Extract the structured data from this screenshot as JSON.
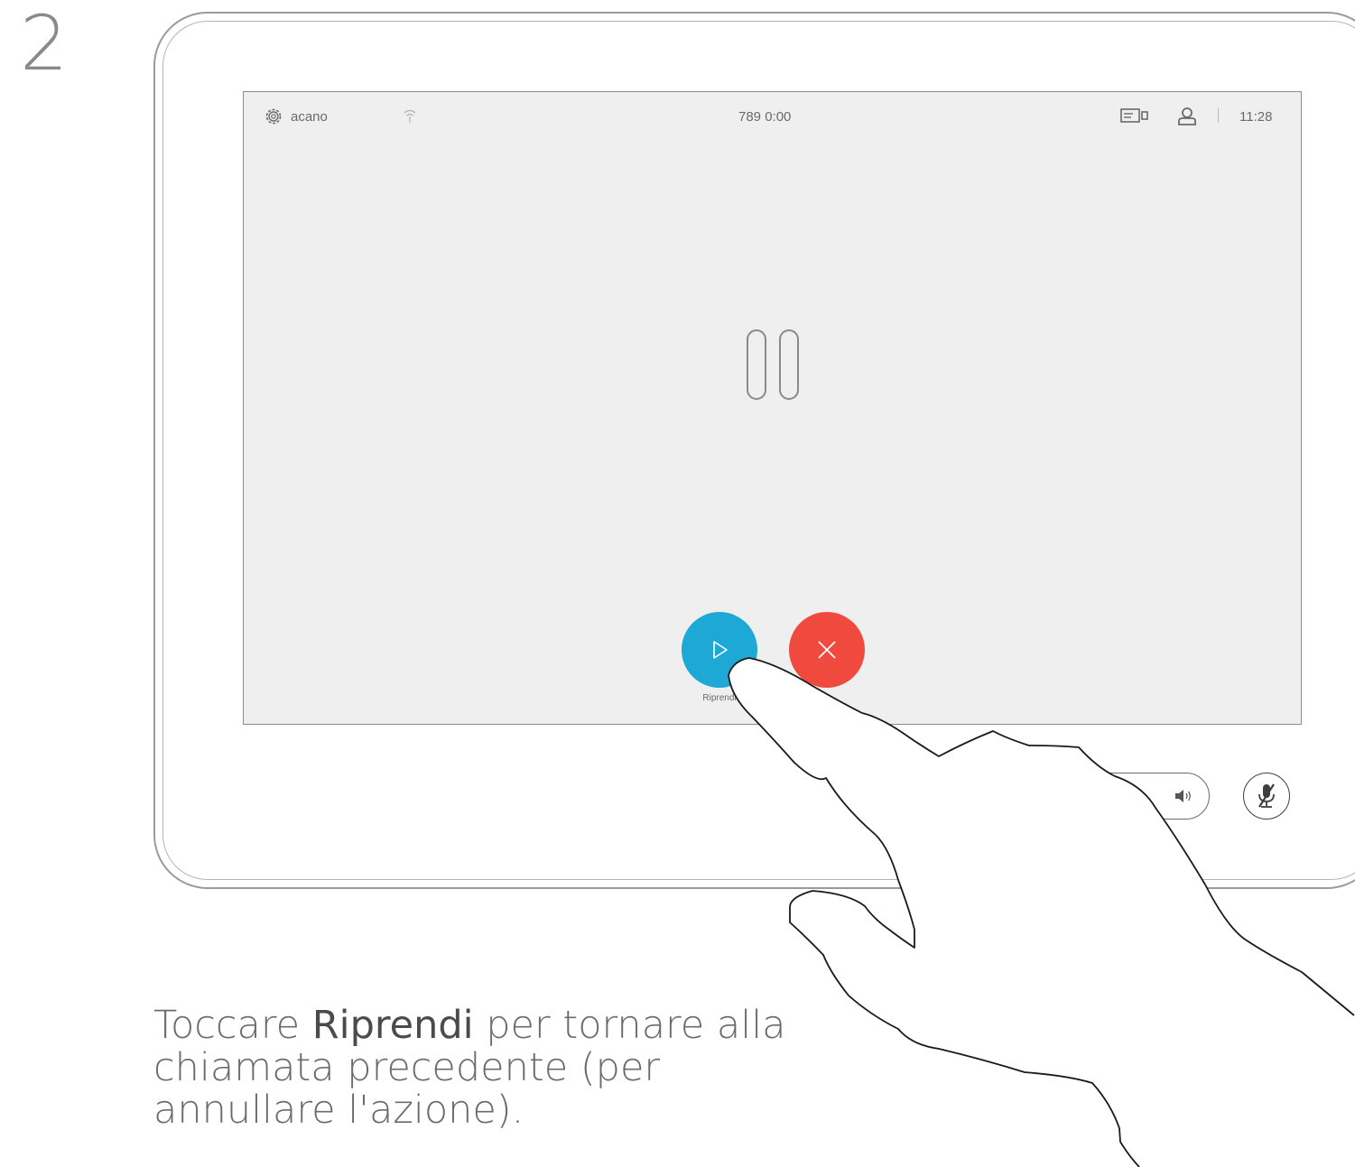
{
  "step": {
    "number": "2"
  },
  "status_bar": {
    "system_name": "acano",
    "call_info": "789  0:00",
    "time": "11:28"
  },
  "call_controls": {
    "resume_label": "Riprendi",
    "resume_icon": "play-icon",
    "end_icon": "close-icon"
  },
  "bottom_bar": {
    "volume_icon": "speaker-icon",
    "mute_icon": "microphone-muted-icon"
  },
  "instruction": {
    "prefix": "Toccare ",
    "highlight": "Riprendi",
    "suffix": " per tornare alla chiamata precedente (per annullare l'azione)."
  },
  "colors": {
    "resume": "#1ea8d6",
    "end_call": "#f04a3e",
    "screen_bg": "#efefef"
  }
}
